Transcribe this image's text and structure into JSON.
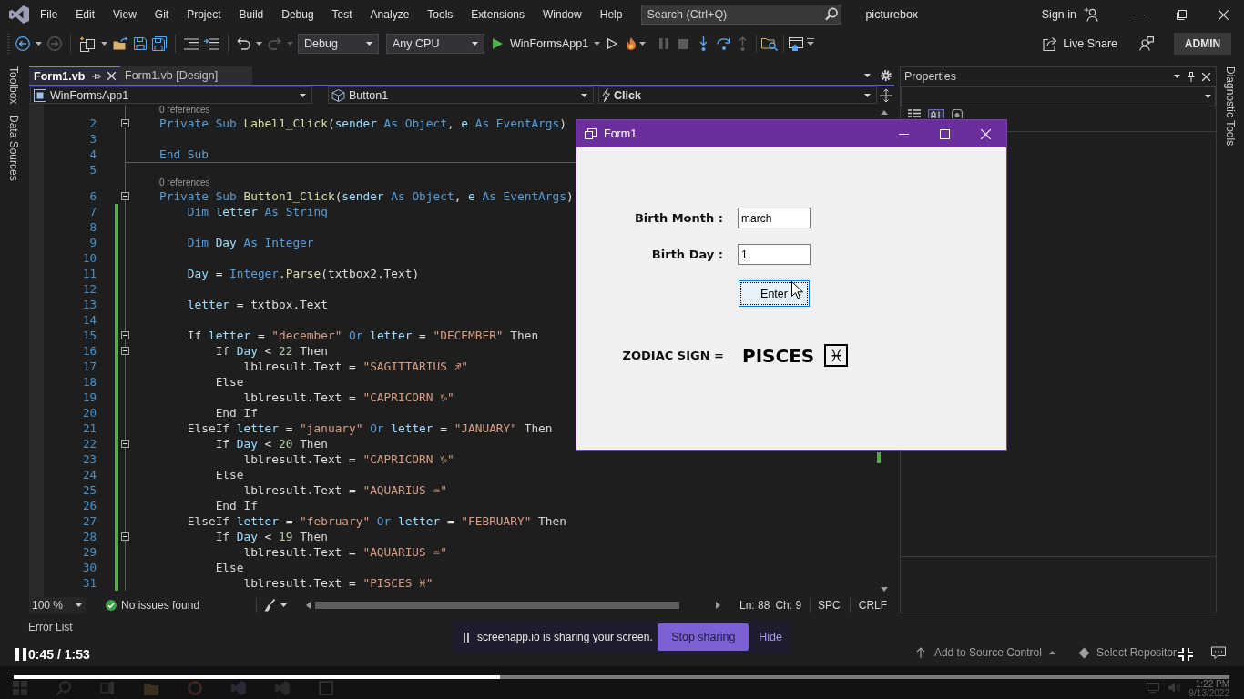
{
  "title_bar": {
    "menu": [
      "File",
      "Edit",
      "View",
      "Git",
      "Project",
      "Build",
      "Debug",
      "Test",
      "Analyze",
      "Tools",
      "Extensions",
      "Window",
      "Help"
    ],
    "search": {
      "placeholder": "Search (Ctrl+Q)"
    },
    "solution_name": "picturebox",
    "sign_in": "Sign in"
  },
  "toolbar": {
    "navigate_back": {
      "disabled": false
    },
    "navigate_forward": {
      "disabled": true
    },
    "undo": {
      "disabled": false
    },
    "redo": {
      "disabled": true
    },
    "configuration": {
      "value": "Debug"
    },
    "platform": {
      "value": "Any CPU"
    },
    "start_target": "WinFormsApp1",
    "pause": {
      "disabled": true
    },
    "stop": {
      "disabled": true
    },
    "step_into": {
      "disabled": false
    },
    "step_over": {
      "disabled": false
    },
    "step_out": {
      "disabled": true
    },
    "live_share": "Live Share",
    "account_badge": "ADMIN"
  },
  "side_tabs_left": [
    "Toolbox",
    "Data Sources"
  ],
  "editor": {
    "tabs": [
      {
        "label": "Form1.vb",
        "selected": true
      },
      {
        "label": "Form1.vb [Design]",
        "selected": false
      }
    ],
    "nav": {
      "project": "WinFormsApp1",
      "object": "Button1",
      "event": "Click"
    },
    "lines": [
      {
        "number": "2",
        "codelens": "0 references",
        "fold": true,
        "changed": false,
        "tokens": [
          {
            "kind": "keyword",
            "text": "Private Sub "
          },
          {
            "kind": "method",
            "text": "Label1_Click"
          },
          {
            "kind": "plain",
            "text": "("
          },
          {
            "kind": "variable",
            "text": "sender"
          },
          {
            "kind": "keyword",
            "text": " As Object"
          },
          {
            "kind": "plain",
            "text": ", "
          },
          {
            "kind": "variable",
            "text": "e"
          },
          {
            "kind": "keyword",
            "text": " As EventArgs"
          },
          {
            "kind": "plain",
            "text": ")"
          }
        ]
      },
      {
        "number": "3",
        "fold": false,
        "changed": false
      },
      {
        "number": "4",
        "fold": false,
        "changed": false,
        "tokens": [
          {
            "kind": "keyword",
            "text": "End Sub"
          }
        ]
      },
      {
        "number": "5",
        "fold": false,
        "changed": false
      },
      {
        "number": "6",
        "codelens": "0 references",
        "fold": true,
        "changed": false,
        "tokens": [
          {
            "kind": "keyword",
            "text": "Private Sub "
          },
          {
            "kind": "method",
            "text": "Button1_Click"
          },
          {
            "kind": "plain",
            "text": "("
          },
          {
            "kind": "variable",
            "text": "sender"
          },
          {
            "kind": "keyword",
            "text": " As Object"
          },
          {
            "kind": "plain",
            "text": ", "
          },
          {
            "kind": "variable",
            "text": "e"
          },
          {
            "kind": "keyword",
            "text": " As EventArgs"
          },
          {
            "kind": "plain",
            "text": ")"
          }
        ]
      },
      {
        "number": "7",
        "fold": false,
        "changed": true,
        "tokens": [
          {
            "kind": "keyword",
            "text": "    Dim "
          },
          {
            "kind": "variable",
            "text": "letter"
          },
          {
            "kind": "keyword",
            "text": " As String"
          }
        ]
      },
      {
        "number": "8",
        "fold": false,
        "changed": true
      },
      {
        "number": "9",
        "fold": false,
        "changed": true,
        "tokens": [
          {
            "kind": "keyword",
            "text": "    Dim "
          },
          {
            "kind": "variable",
            "text": "Day"
          },
          {
            "kind": "keyword",
            "text": " As Integer"
          }
        ]
      },
      {
        "number": "10",
        "fold": false,
        "changed": true
      },
      {
        "number": "11",
        "fold": false,
        "changed": true,
        "tokens": [
          {
            "kind": "variable",
            "text": "    Day"
          },
          {
            "kind": "plain",
            "text": " = "
          },
          {
            "kind": "keyword",
            "text": "Integer"
          },
          {
            "kind": "plain",
            "text": "."
          },
          {
            "kind": "method",
            "text": "Parse"
          },
          {
            "kind": "plain",
            "text": "(txtbox2.Text)"
          }
        ]
      },
      {
        "number": "12",
        "fold": false,
        "changed": true
      },
      {
        "number": "13",
        "fold": false,
        "changed": true,
        "tokens": [
          {
            "kind": "variable",
            "text": "    letter"
          },
          {
            "kind": "plain",
            "text": " = txtbox.Text"
          }
        ]
      },
      {
        "number": "14",
        "fold": false,
        "changed": true
      },
      {
        "number": "15",
        "fold": true,
        "changed": true,
        "tokens": [
          {
            "kind": "control",
            "text": "    If "
          },
          {
            "kind": "variable",
            "text": "letter"
          },
          {
            "kind": "plain",
            "text": " = "
          },
          {
            "kind": "string",
            "text": "\"december\""
          },
          {
            "kind": "keyword",
            "text": " Or "
          },
          {
            "kind": "variable",
            "text": "letter"
          },
          {
            "kind": "plain",
            "text": " = "
          },
          {
            "kind": "string",
            "text": "\"DECEMBER\""
          },
          {
            "kind": "control",
            "text": " Then"
          }
        ]
      },
      {
        "number": "16",
        "fold": true,
        "changed": true,
        "tokens": [
          {
            "kind": "control",
            "text": "        If "
          },
          {
            "kind": "variable",
            "text": "Day"
          },
          {
            "kind": "plain",
            "text": " < "
          },
          {
            "kind": "number",
            "text": "22"
          },
          {
            "kind": "control",
            "text": " Then"
          }
        ]
      },
      {
        "number": "17",
        "fold": false,
        "changed": true,
        "tokens": [
          {
            "kind": "plain",
            "text": "            lblresult.Text = "
          },
          {
            "kind": "string",
            "text": "\"SAGITTARIUS ♐\""
          }
        ]
      },
      {
        "number": "18",
        "fold": false,
        "changed": true,
        "tokens": [
          {
            "kind": "control",
            "text": "        Else"
          }
        ]
      },
      {
        "number": "19",
        "fold": false,
        "changed": true,
        "tokens": [
          {
            "kind": "plain",
            "text": "            lblresult.Text = "
          },
          {
            "kind": "string",
            "text": "\"CAPRICORN ♑\""
          }
        ]
      },
      {
        "number": "20",
        "fold": false,
        "changed": true,
        "tokens": [
          {
            "kind": "control",
            "text": "        End If"
          }
        ]
      },
      {
        "number": "21",
        "fold": false,
        "changed": true,
        "tokens": [
          {
            "kind": "control",
            "text": "    ElseIf "
          },
          {
            "kind": "variable",
            "text": "letter"
          },
          {
            "kind": "plain",
            "text": " = "
          },
          {
            "kind": "string",
            "text": "\"january\""
          },
          {
            "kind": "keyword",
            "text": " Or "
          },
          {
            "kind": "variable",
            "text": "letter"
          },
          {
            "kind": "plain",
            "text": " = "
          },
          {
            "kind": "string",
            "text": "\"JANUARY\""
          },
          {
            "kind": "control",
            "text": " Then"
          }
        ]
      },
      {
        "number": "22",
        "fold": true,
        "changed": true,
        "tokens": [
          {
            "kind": "control",
            "text": "        If "
          },
          {
            "kind": "variable",
            "text": "Day"
          },
          {
            "kind": "plain",
            "text": " < "
          },
          {
            "kind": "number",
            "text": "20"
          },
          {
            "kind": "control",
            "text": " Then"
          }
        ]
      },
      {
        "number": "23",
        "fold": false,
        "changed": true,
        "tokens": [
          {
            "kind": "plain",
            "text": "            lblresult.Text = "
          },
          {
            "kind": "string",
            "text": "\"CAPRICORN ♑\""
          }
        ]
      },
      {
        "number": "24",
        "fold": false,
        "changed": true,
        "tokens": [
          {
            "kind": "control",
            "text": "        Else"
          }
        ]
      },
      {
        "number": "25",
        "fold": false,
        "changed": true,
        "tokens": [
          {
            "kind": "plain",
            "text": "            lblresult.Text = "
          },
          {
            "kind": "string",
            "text": "\"AQUARIUS ♒\""
          }
        ]
      },
      {
        "number": "26",
        "fold": false,
        "changed": true,
        "tokens": [
          {
            "kind": "control",
            "text": "        End If"
          }
        ]
      },
      {
        "number": "27",
        "fold": false,
        "changed": true,
        "tokens": [
          {
            "kind": "control",
            "text": "    ElseIf "
          },
          {
            "kind": "variable",
            "text": "letter"
          },
          {
            "kind": "plain",
            "text": " = "
          },
          {
            "kind": "string",
            "text": "\"february\""
          },
          {
            "kind": "keyword",
            "text": " Or "
          },
          {
            "kind": "variable",
            "text": "letter"
          },
          {
            "kind": "plain",
            "text": " = "
          },
          {
            "kind": "string",
            "text": "\"FEBRUARY\""
          },
          {
            "kind": "control",
            "text": " Then"
          }
        ]
      },
      {
        "number": "28",
        "fold": true,
        "changed": true,
        "tokens": [
          {
            "kind": "control",
            "text": "        If "
          },
          {
            "kind": "variable",
            "text": "Day"
          },
          {
            "kind": "plain",
            "text": " < "
          },
          {
            "kind": "number",
            "text": "19"
          },
          {
            "kind": "control",
            "text": " Then"
          }
        ]
      },
      {
        "number": "29",
        "fold": false,
        "changed": true,
        "tokens": [
          {
            "kind": "plain",
            "text": "            lblresult.Text = "
          },
          {
            "kind": "string",
            "text": "\"AQUARIUS ♒\""
          }
        ]
      },
      {
        "number": "30",
        "fold": false,
        "changed": true,
        "tokens": [
          {
            "kind": "control",
            "text": "        Else"
          }
        ]
      },
      {
        "number": "31",
        "fold": false,
        "changed": true,
        "tokens": [
          {
            "kind": "plain",
            "text": "            lblresult.Text = "
          },
          {
            "kind": "string",
            "text": "\"PISCES ♓\""
          }
        ]
      }
    ],
    "status": {
      "zoom": "100 %",
      "issues": "No issues found",
      "line": "Ln: 88",
      "column": "Ch: 9",
      "whitespace": "SPC",
      "line_ending": "CRLF"
    }
  },
  "properties": {
    "title": "Properties"
  },
  "side_tabs_right": [
    "Diagnostic Tools"
  ],
  "bottom_tabs": [
    "Error List"
  ],
  "status_bar": {
    "source_control": "Add to Source Control",
    "repository": "Select Repositor"
  },
  "form_window": {
    "title": "Form1",
    "fields": [
      {
        "label": "Birth Month :",
        "value": "march"
      },
      {
        "label": "Birth Day :",
        "value": "1"
      }
    ],
    "button": {
      "label": "Enter",
      "focused": true
    },
    "result_label": "ZODIAC SIGN =",
    "result": "PISCES",
    "result_symbol": "♓"
  },
  "screen_share": {
    "message": "screenapp.io is sharing your screen.",
    "stop": "Stop sharing",
    "hide": "Hide"
  },
  "video_player": {
    "time": "0:45 / 1:53",
    "progress": {
      "level": 0.4
    }
  },
  "taskbar": {
    "time": "1:22 PM",
    "date": "9/13/2022"
  }
}
